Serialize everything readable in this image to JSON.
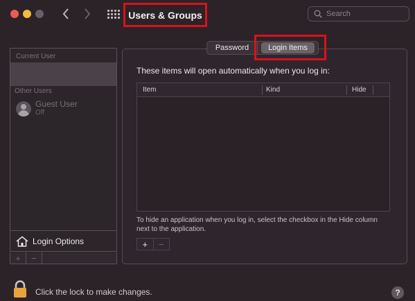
{
  "window": {
    "title": "Users & Groups"
  },
  "search": {
    "placeholder": "Search"
  },
  "sidebar": {
    "current_user_label": "Current User",
    "other_users_label": "Other Users",
    "guest_name": "Guest User",
    "guest_status": "Off",
    "login_options_label": "Login Options",
    "add_symbol": "+",
    "remove_symbol": "−"
  },
  "tabs": [
    {
      "label": "Password",
      "selected": false
    },
    {
      "label": "Login Items",
      "selected": true
    }
  ],
  "login_items": {
    "description": "These items will open automatically when you log in:",
    "columns": [
      "Item",
      "Kind",
      "Hide"
    ],
    "rows": [],
    "hint": "To hide an application when you log in, select the checkbox in the Hide column next to the application.",
    "add_symbol": "+",
    "remove_symbol": "−"
  },
  "footer": {
    "lock_text": "Click the lock to make changes.",
    "help_symbol": "?"
  },
  "colors": {
    "highlight_box": "#d8121c",
    "close": "#ee5b50",
    "minimize": "#f3bd3b",
    "lock": "#e8a43a"
  },
  "icons": [
    "back-chevron-icon",
    "forward-chevron-icon",
    "grid-icon",
    "search-icon",
    "guest-avatar-icon",
    "house-icon",
    "lock-icon",
    "help-icon"
  ]
}
